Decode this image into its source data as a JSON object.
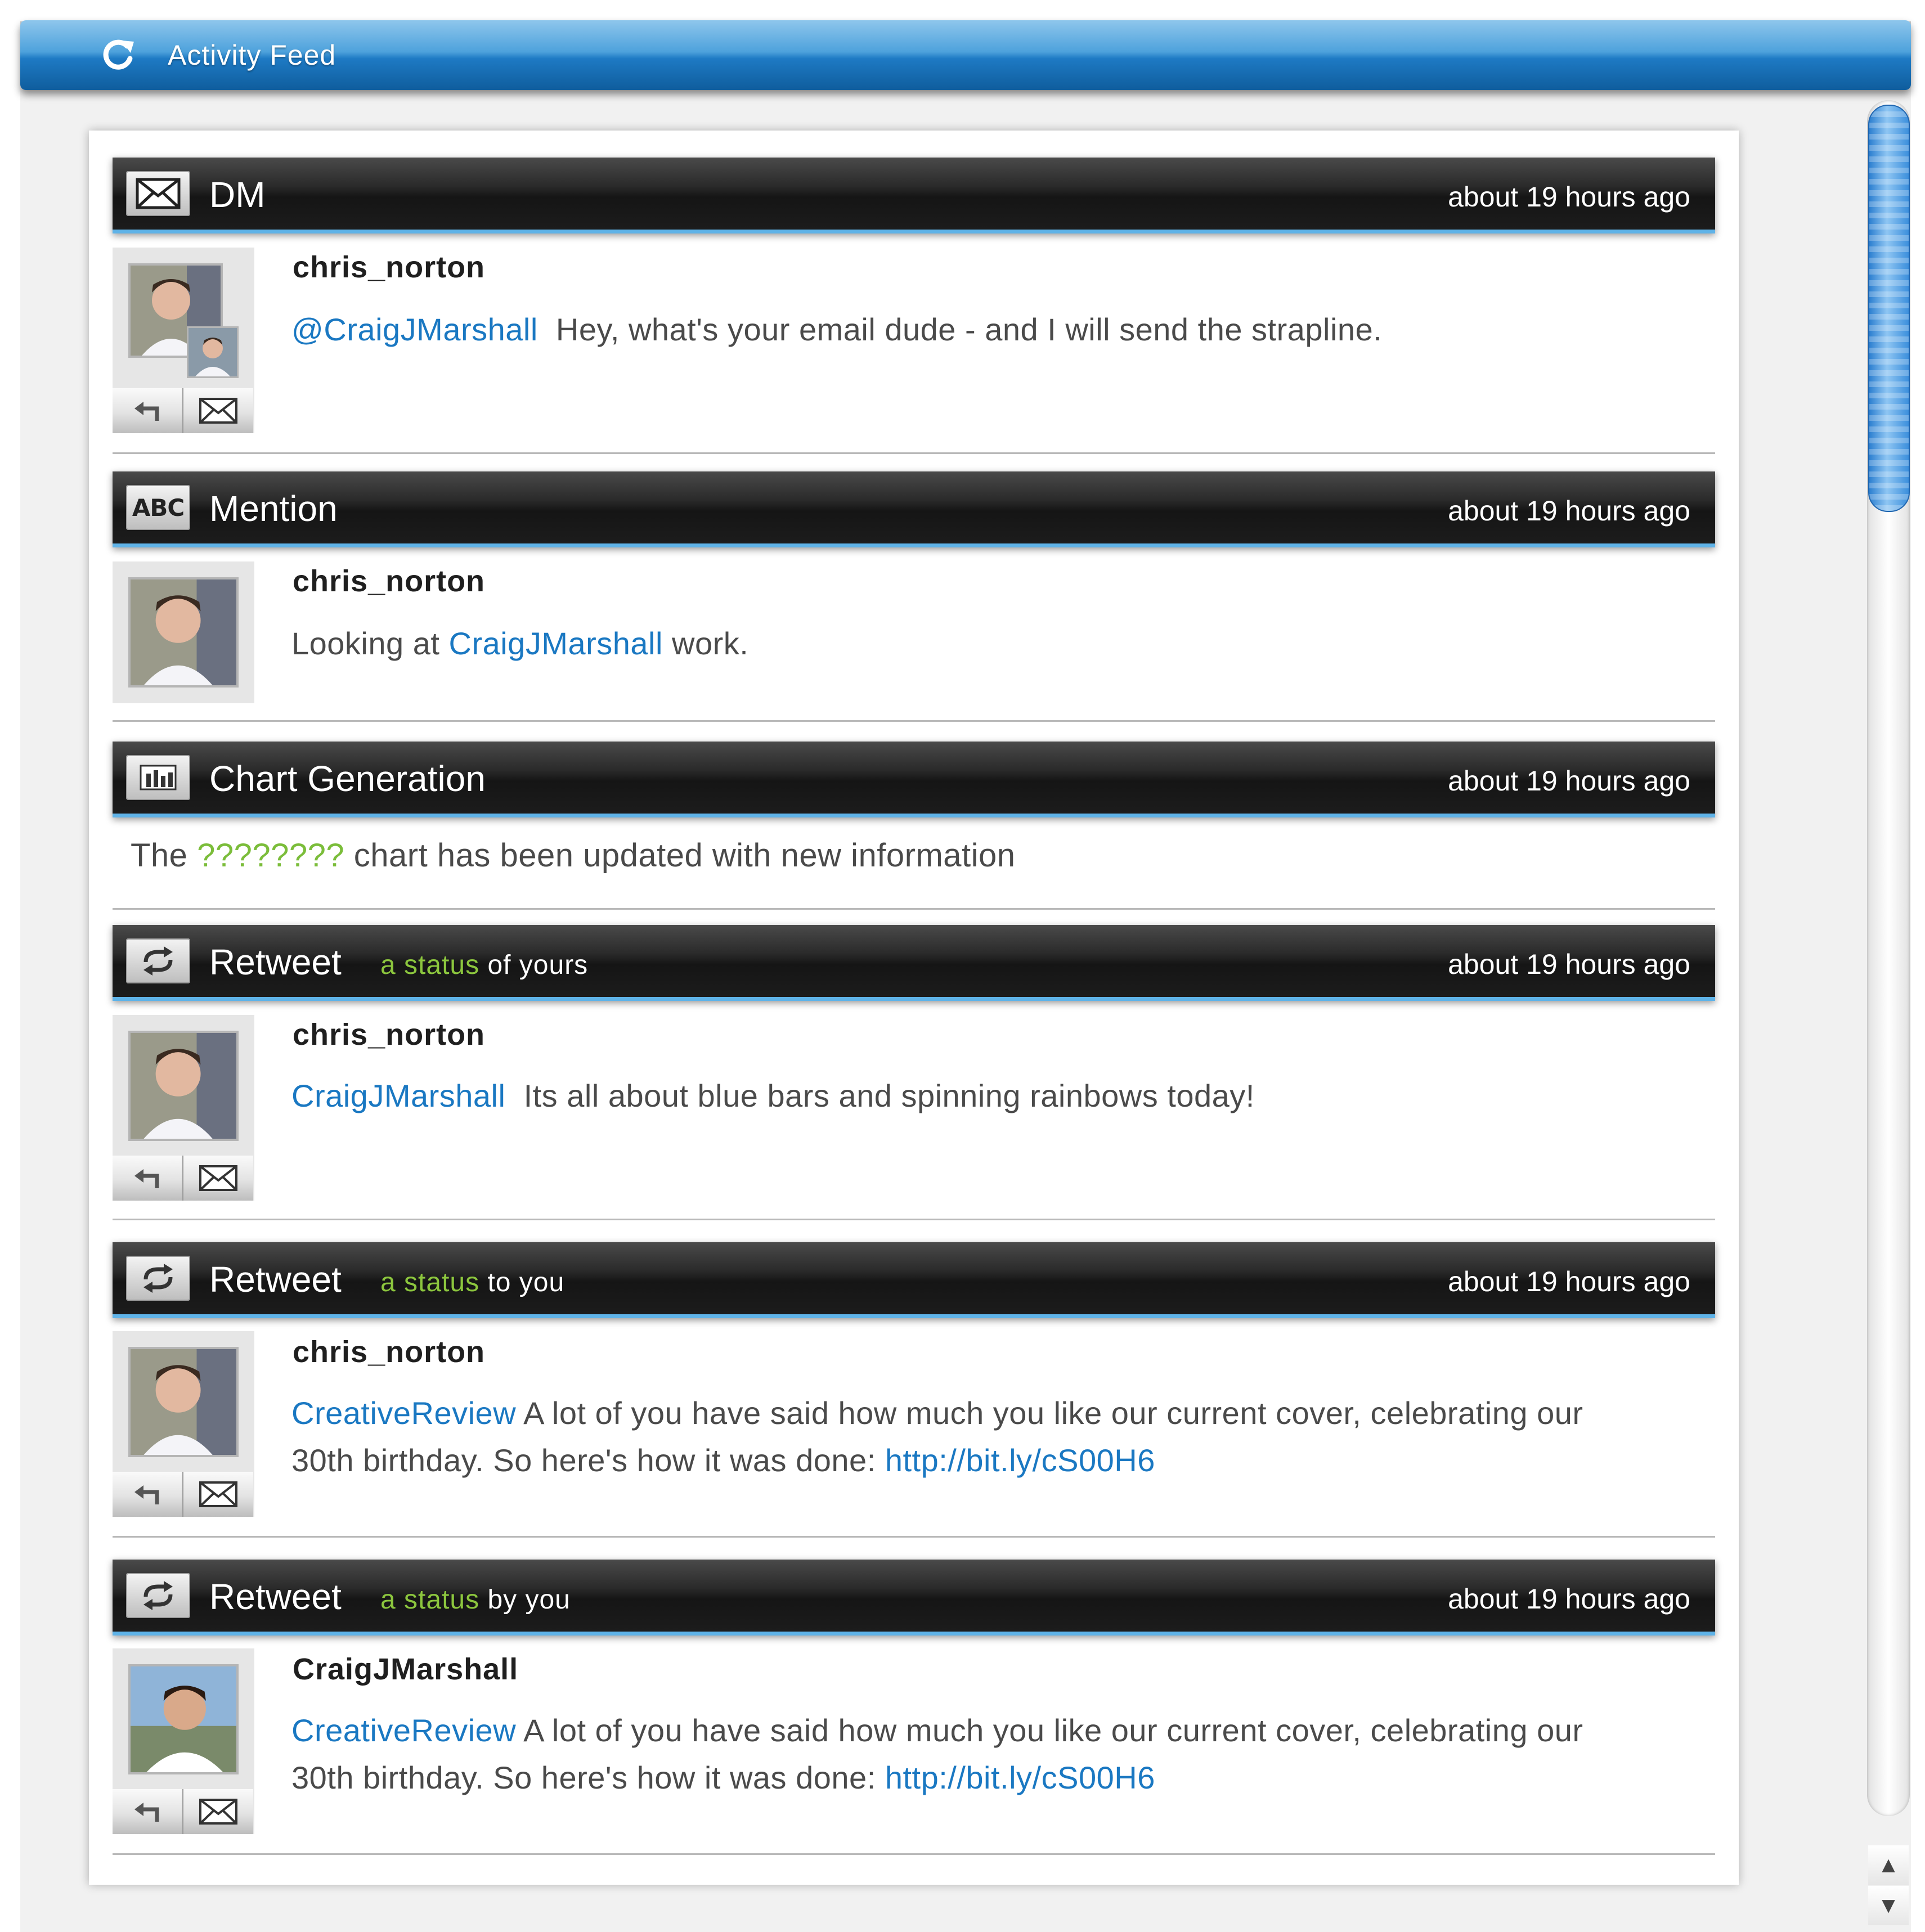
{
  "window": {
    "title": "Activity Feed",
    "icon": "refresh-icon"
  },
  "feed": [
    {
      "type": "DM",
      "icon": "envelope-icon",
      "time": "about 19 hours ago",
      "user": "chris_norton",
      "mention": "@CraigJMarshall",
      "text": "Hey, what's your email dude - and I will send the strapline."
    },
    {
      "type": "Mention",
      "icon": "abc-icon",
      "icon_text": "ABC",
      "time": "about 19 hours ago",
      "user": "chris_norton",
      "text_before": "Looking at",
      "mention": "CraigJMarshall",
      "text_after": "work."
    },
    {
      "type": "Chart Generation",
      "icon": "bar-chart-icon",
      "time": "about 19 hours ago",
      "text_before": "The",
      "chart_name": "????????",
      "text_after": "chart has been updated with new information"
    },
    {
      "type": "Retweet",
      "icon": "retweet-icon",
      "sub_green": "a status",
      "sub_rest": "of yours",
      "time": "about 19 hours ago",
      "user": "chris_norton",
      "mention": "CraigJMarshall",
      "text": "Its all about blue bars and spinning rainbows today!"
    },
    {
      "type": "Retweet",
      "icon": "retweet-icon",
      "sub_green": "a status",
      "sub_rest": "to you",
      "time": "about 19 hours ago",
      "user": "chris_norton",
      "mention": "CreativeReview",
      "text_line1": "A lot of you have said how much you like our current cover, celebrating our",
      "text_line2": "30th birthday. So here's how it was done:",
      "url": "http://bit.ly/cS00H6"
    },
    {
      "type": "Retweet",
      "icon": "retweet-icon",
      "sub_green": "a status",
      "sub_rest": "by you",
      "time": "about 19 hours ago",
      "user": "CraigJMarshall",
      "mention": "CreativeReview",
      "text_line1": "A lot of you have said how much you like our current cover, celebrating our",
      "text_line2": "30th birthday. So here's how it was done:",
      "url": "http://bit.ly/cS00H6"
    }
  ],
  "scrollbar": {
    "up_arrow": "▲",
    "down_arrow": "▼"
  },
  "colors": {
    "accent_blue": "#1a78c2",
    "green": "#8cc63e",
    "title_bar": "#2a84cc"
  }
}
